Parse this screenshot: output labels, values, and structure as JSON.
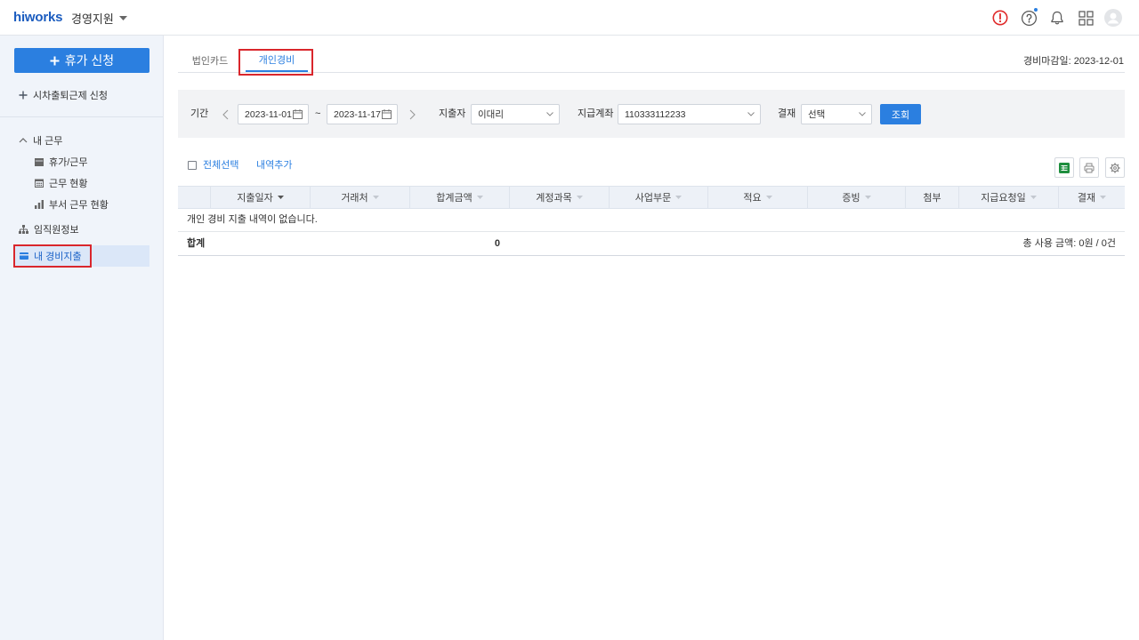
{
  "header": {
    "logo": "hiworks",
    "app_name": "경영지원",
    "icons": {
      "alert": "alert-icon",
      "help": "help-icon",
      "notifications": "bell-icon",
      "apps": "apps-grid-icon",
      "profile": "avatar-icon"
    }
  },
  "sidebar": {
    "leave_request_button": "휴가 신청",
    "flex_time_request": "시차출퇴근제 신청",
    "my_work": {
      "label": "내 근무",
      "expanded": true,
      "items": [
        {
          "label": "휴가/근무",
          "icon": "calendar-icon"
        },
        {
          "label": "근무 현황",
          "icon": "calendar-grid-icon"
        },
        {
          "label": "부서 근무 현황",
          "icon": "bar-chart-icon"
        }
      ]
    },
    "employee_info": "임직원정보",
    "my_expenses": "내 경비지출",
    "selected": "my_expenses"
  },
  "tabs": [
    {
      "label": "법인카드",
      "active": false
    },
    {
      "label": "개인경비",
      "active": true
    }
  ],
  "closing_date": "경비마감일: 2023-12-01",
  "filters": {
    "period_label": "기간",
    "start_date": "2023-11-01",
    "range_separator": "~",
    "end_date": "2023-11-17",
    "spender_label": "지출자",
    "spender_value": "이대리",
    "account_label": "지급계좌",
    "account_value": "110333112233",
    "approval_label": "결재",
    "approval_value": "선택",
    "search_button": "조회"
  },
  "actions": {
    "select_all": "전체선택",
    "select_all_checked": false,
    "add_entry": "내역추가",
    "icons": [
      "excel-download-icon",
      "print-icon",
      "settings-icon"
    ]
  },
  "table": {
    "columns": [
      {
        "label": "지출일자",
        "sorted": true
      },
      {
        "label": "거래처",
        "sorted": false
      },
      {
        "label": "합계금액",
        "sorted": false
      },
      {
        "label": "계정과목",
        "sorted": false
      },
      {
        "label": "사업부문",
        "sorted": false
      },
      {
        "label": "적요",
        "sorted": false
      },
      {
        "label": "증빙",
        "sorted": false
      },
      {
        "label": "첨부",
        "sortable": false
      },
      {
        "label": "지급요청일",
        "sorted": false
      },
      {
        "label": "결재",
        "sorted": false
      }
    ],
    "empty_message": "개인 경비 지출 내역이 없습니다.",
    "totals": {
      "label": "합계",
      "amount": "0",
      "summary": "총 사용 금액: 0원 / 0건"
    }
  },
  "colors": {
    "brand_blue": "#1b5cbf",
    "primary": "#2b7fe0",
    "highlight_red": "#d9262c",
    "alert_red": "#e02a2a",
    "excel_green": "#1e8e3e",
    "sidebar_bg": "#f0f4fa",
    "selected_bg": "#dbe7f8"
  }
}
